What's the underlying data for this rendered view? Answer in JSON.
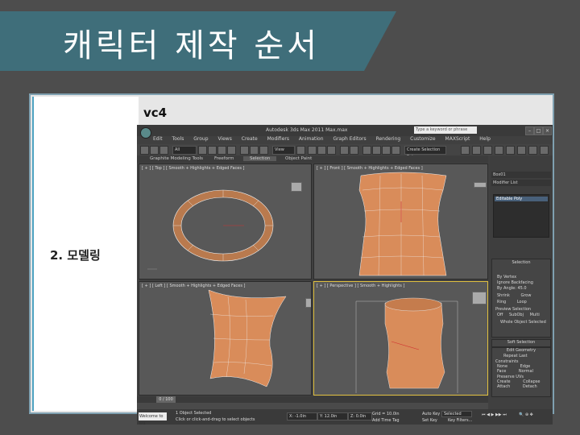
{
  "slide": {
    "title": "캐릭터 제작 순서",
    "step_label": "2. 모델링",
    "caption": "vc4",
    "banner_color": "#3f6e7a",
    "sidebar_color": "#4fa3c2"
  },
  "app": {
    "title": "Autodesk 3ds Max  2011    Max.max",
    "search_placeholder": "Type a keyword or phrase",
    "menu": [
      "Edit",
      "Tools",
      "Group",
      "Views",
      "Create",
      "Modifiers",
      "Animation",
      "Graph Editors",
      "Rendering",
      "Customize",
      "MAXScript",
      "Help"
    ],
    "toolbar": {
      "filter": "All",
      "view": "View",
      "selection_set": "Create Selection Set"
    },
    "ribbon": {
      "tabs": [
        "Graphite Modeling Tools",
        "Freeform",
        "Selection",
        "Object Paint"
      ],
      "active_index": 2
    },
    "viewports": [
      {
        "label": "[ + ] [ Top ] [ Smooth + Highlights + Edged Faces ]"
      },
      {
        "label": "[ + ] [ Front ] [ Smooth + Highlights + Edged Faces ]"
      },
      {
        "label": "[ + ] [ Left ] [ Smooth + Highlights + Edged Faces ]"
      },
      {
        "label": "[ + ] [ Perspective ] [ Smooth + Highlights ]"
      }
    ],
    "command_panel": {
      "object_name": "Box01",
      "modifier_list": "Modifier List",
      "stack_item": "Editable Poly",
      "selection_header": "Selection",
      "selection_options": [
        "By Vertex",
        "Ignore Backfacing",
        "By Angle: 45.0"
      ],
      "buttons": [
        "Shrink",
        "Grow",
        "Ring",
        "Loop"
      ],
      "preview_header": "Preview Selection",
      "preview_options": [
        "Off",
        "SubObj",
        "Multi"
      ],
      "whole_object": "Whole Object Selected",
      "soft_selection": "Soft Selection",
      "edit_geometry": "Edit Geometry",
      "repeat_last": "Repeat Last",
      "constraints_header": "Constraints",
      "constraints": [
        "None",
        "Edge",
        "Face",
        "Normal"
      ],
      "preserve_uvs": "Preserve UVs",
      "create": "Create",
      "collapse": "Collapse",
      "attach": "Attach",
      "detach": "Detach"
    },
    "time_slider": {
      "frame": "0 / 100"
    },
    "status": {
      "welcome": "Welcome to MA",
      "selection_msg": "1 Object Selected",
      "prompt": "Click or click-and-drag to select objects",
      "x": "X: -1.0in",
      "y": "Y: 12.0in",
      "z": "Z: 0.0in",
      "grid": "Grid = 10.0in",
      "add_time_tag": "Add Time Tag",
      "autokey": "Auto Key",
      "selected": "Selected",
      "set_key": "Set Key",
      "key_filters": "Key Filters..."
    },
    "model_color": "#d98c5a",
    "selection_color": "#e0c040"
  }
}
